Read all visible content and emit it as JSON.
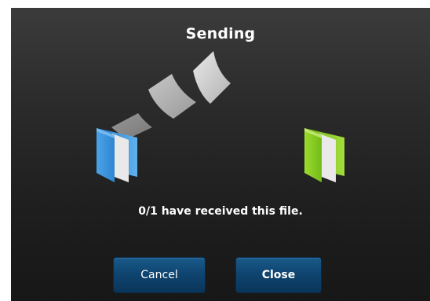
{
  "dialog": {
    "title": "Sending",
    "status_text": "0/1 have received this file.",
    "buttons": {
      "cancel_label": "Cancel",
      "close_label": "Close"
    },
    "icons": {
      "source_folder": "blue-folder-icon",
      "destination_folder": "green-folder-icon",
      "flying_pages": "document-page-icon"
    },
    "colors": {
      "source_folder": "#3b8fd6",
      "destination_folder": "#8ccf24",
      "button": "#0f4570"
    }
  }
}
